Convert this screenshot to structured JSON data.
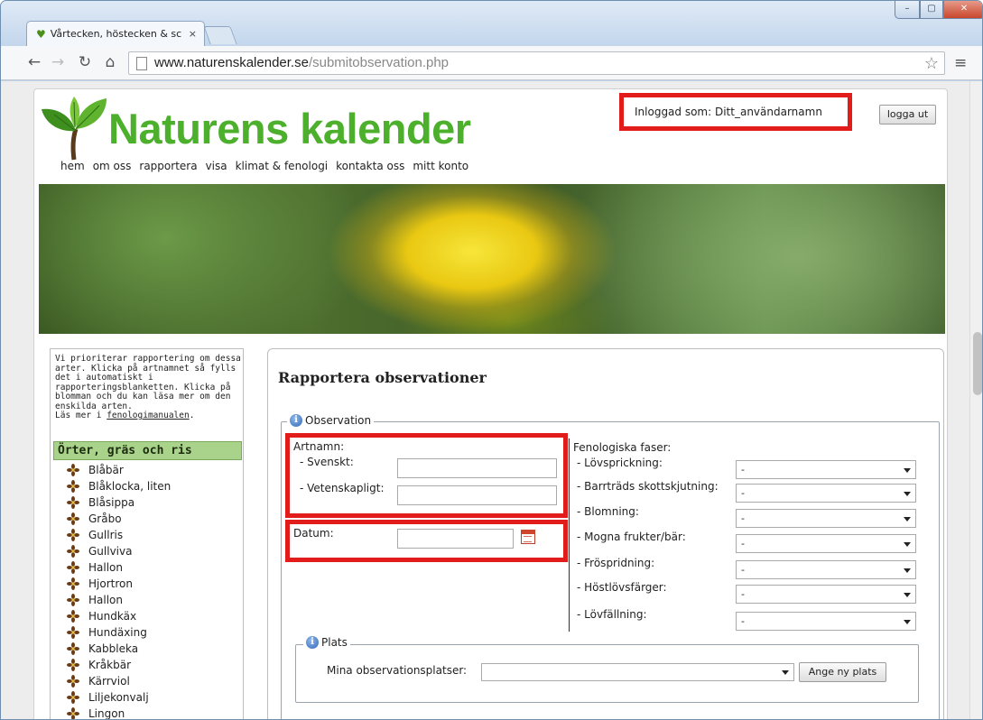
{
  "browser": {
    "tab_title": "Vårtecken, höstecken & sc",
    "tab_close": "×",
    "window_controls": {
      "minimize": "–",
      "maximize": "▢",
      "close": "✕"
    },
    "url_host": "www.naturenskalender.se",
    "url_path": "/submitobservation.php",
    "icons": {
      "back": "back-arrow-icon",
      "forward": "forward-arrow-icon",
      "reload": "reload-icon",
      "home": "home-icon",
      "star": "bookmark-star-icon",
      "menu": "menu-icon"
    }
  },
  "header": {
    "site_title": "Naturens kalender",
    "nav": [
      "hem",
      "om oss",
      "rapportera",
      "visa",
      "klimat & fenologi",
      "kontakta oss",
      "mitt konto"
    ],
    "login_status": "Inloggad som: Ditt_användarnamn",
    "logout_label": "logga ut"
  },
  "colors": {
    "brand_green": "#4cb02c",
    "highlight_red": "#e21b1b",
    "category_green": "#a9d38b"
  },
  "sidebar": {
    "intro_text": "Vi prioriterar rapportering om dessa arter. Klicka på artnamnet så fylls det i automatiskt i rapporteringsblanketten. Klicka på blomman och du kan läsa mer om den enskilda arten.",
    "read_more_prefix": "Läs mer i ",
    "read_more_link": "fenologimanualen",
    "read_more_suffix": ".",
    "category": "Örter, gräs och ris",
    "species": [
      "Blåbär",
      "Blåklocka, liten",
      "Blåsippa",
      "Gråbo",
      "Gullris",
      "Gullviva",
      "Hallon",
      "Hjortron",
      "Hallon",
      "Hundkäx",
      "Hundäxing",
      "Kabbleka",
      "Kråkbär",
      "Kärrviol",
      "Liljekonvalj",
      "Lingon"
    ]
  },
  "form": {
    "title": "Rapportera observationer",
    "observation_legend": "Observation",
    "artnamn_label": "Artnamn:",
    "svenskt_label": "- Svenskt:",
    "vetenskapligt_label": "- Vetenskapligt:",
    "svenskt_value": "",
    "vetenskapligt_value": "",
    "datum_label": "Datum:",
    "datum_value": "",
    "phases_title": "Fenologiska faser:",
    "phases": [
      {
        "label": "- Lövsprickning:",
        "value": "-"
      },
      {
        "label": "- Barrträds skottskjutning:",
        "value": "-"
      },
      {
        "label": "- Blomning:",
        "value": "-"
      },
      {
        "label": "- Mogna frukter/bär:",
        "value": "-"
      },
      {
        "label": "- Fröspridning:",
        "value": "-"
      },
      {
        "label": "- Höstlövsfärger:",
        "value": "-"
      },
      {
        "label": "- Lövfällning:",
        "value": "-"
      }
    ],
    "plats_legend": "Plats",
    "mina_platser_label": "Mina observationsplatser:",
    "mina_platser_value": "",
    "ny_plats_label": "Ange ny plats"
  }
}
